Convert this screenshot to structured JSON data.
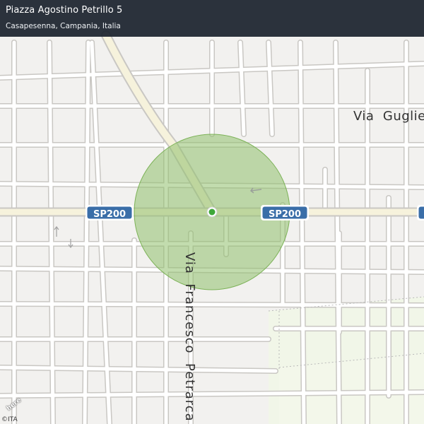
{
  "header": {
    "title": "Piazza Agostino Petrillo 5",
    "subtitle": "Casapesenna, Campania, Italia"
  },
  "map": {
    "road_labels": [
      {
        "id": "sp200-left",
        "text": "SP200"
      },
      {
        "id": "sp200-right",
        "text": "SP200"
      }
    ],
    "street_labels": {
      "via_gugli": "Via  Guglie",
      "via_francesco": "Via  Francesco  Petrarca"
    },
    "colors": {
      "background": "#f2f1ef",
      "road": "#ffffff",
      "road_casing": "#c9c7c3",
      "main_road": "#f6f2dc",
      "accuracy_circle": "#8fc06b",
      "location_dot": "#3fa83a",
      "shield_blue": "#3a6ea8",
      "header_bg": "#1c242e"
    },
    "icons": [
      "location-dot-icon",
      "oneway-arrow-icon"
    ]
  },
  "attribution": {
    "logo": "here",
    "copyright": "©ITA"
  }
}
